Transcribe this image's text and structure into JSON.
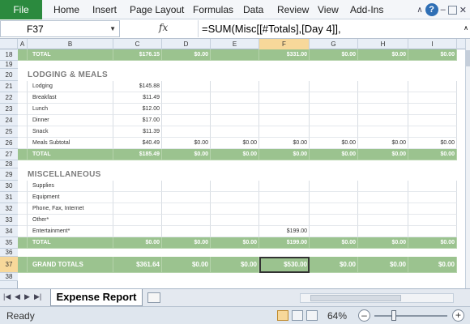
{
  "ribbon": {
    "tabs": [
      "File",
      "Home",
      "Insert",
      "Page Layout",
      "Formulas",
      "Data",
      "Review",
      "View",
      "Add-Ins"
    ]
  },
  "formula_bar": {
    "name_box": "F37",
    "fx": "fx",
    "formula": "=SUM(Misc[[#Totals],[Day 4]],"
  },
  "columns": [
    "A",
    "B",
    "C",
    "D",
    "E",
    "F",
    "G",
    "H",
    "I"
  ],
  "rows": [
    {
      "num": "18",
      "type": "total",
      "label": "TOTAL",
      "values": [
        "$176.15",
        "$0.00",
        "",
        "$331.00",
        "$0.00",
        "$0.00",
        "$0.00"
      ]
    },
    {
      "num": "19",
      "type": "blank"
    },
    {
      "num": "20",
      "type": "section",
      "label": "LODGING & MEALS"
    },
    {
      "num": "21",
      "type": "item",
      "label": "Lodging",
      "values": [
        "$145.88",
        "",
        "",
        "",
        "",
        "",
        ""
      ]
    },
    {
      "num": "22",
      "type": "item",
      "label": "Breakfast",
      "values": [
        "$11.49",
        "",
        "",
        "",
        "",
        "",
        ""
      ]
    },
    {
      "num": "23",
      "type": "item",
      "label": "Lunch",
      "values": [
        "$12.00",
        "",
        "",
        "",
        "",
        "",
        ""
      ]
    },
    {
      "num": "24",
      "type": "item",
      "label": "Dinner",
      "values": [
        "$17.00",
        "",
        "",
        "",
        "",
        "",
        ""
      ]
    },
    {
      "num": "25",
      "type": "item",
      "label": "Snack",
      "values": [
        "$11.39",
        "",
        "",
        "",
        "",
        "",
        ""
      ]
    },
    {
      "num": "26",
      "type": "item",
      "label": "Meals Subtotal",
      "values": [
        "$40.49",
        "$0.00",
        "$0.00",
        "$0.00",
        "$0.00",
        "$0.00",
        "$0.00"
      ]
    },
    {
      "num": "27",
      "type": "total",
      "label": "TOTAL",
      "values": [
        "$185.49",
        "$0.00",
        "$0.00",
        "$0.00",
        "$0.00",
        "$0.00",
        "$0.00"
      ]
    },
    {
      "num": "28",
      "type": "blank"
    },
    {
      "num": "29",
      "type": "section",
      "label": "MISCELLANEOUS"
    },
    {
      "num": "30",
      "type": "item",
      "label": "Supplies",
      "values": [
        "",
        "",
        "",
        "",
        "",
        "",
        ""
      ]
    },
    {
      "num": "31",
      "type": "item",
      "label": "Equipment",
      "values": [
        "",
        "",
        "",
        "",
        "",
        "",
        ""
      ]
    },
    {
      "num": "32",
      "type": "item",
      "label": "Phone, Fax, Internet",
      "values": [
        "",
        "",
        "",
        "",
        "",
        "",
        ""
      ]
    },
    {
      "num": "33",
      "type": "item",
      "label": "Other*",
      "values": [
        "",
        "",
        "",
        "",
        "",
        "",
        ""
      ]
    },
    {
      "num": "34",
      "type": "item",
      "label": "Entertainment*",
      "values": [
        "",
        "",
        "",
        "$199.00",
        "",
        "",
        ""
      ]
    },
    {
      "num": "35",
      "type": "total",
      "label": "TOTAL",
      "values": [
        "$0.00",
        "$0.00",
        "$0.00",
        "$199.00",
        "$0.00",
        "$0.00",
        "$0.00"
      ]
    },
    {
      "num": "36",
      "type": "blank"
    },
    {
      "num": "37",
      "type": "grand",
      "label": "GRAND TOTALS",
      "values": [
        "$361.64",
        "$0.00",
        "$0.00",
        "$530.00",
        "$0.00",
        "$0.00",
        "$0.00"
      ]
    },
    {
      "num": "38",
      "type": "blank"
    }
  ],
  "sheet_tabs": {
    "active": "Expense Report"
  },
  "status_bar": {
    "mode": "Ready",
    "zoom": "64%"
  }
}
